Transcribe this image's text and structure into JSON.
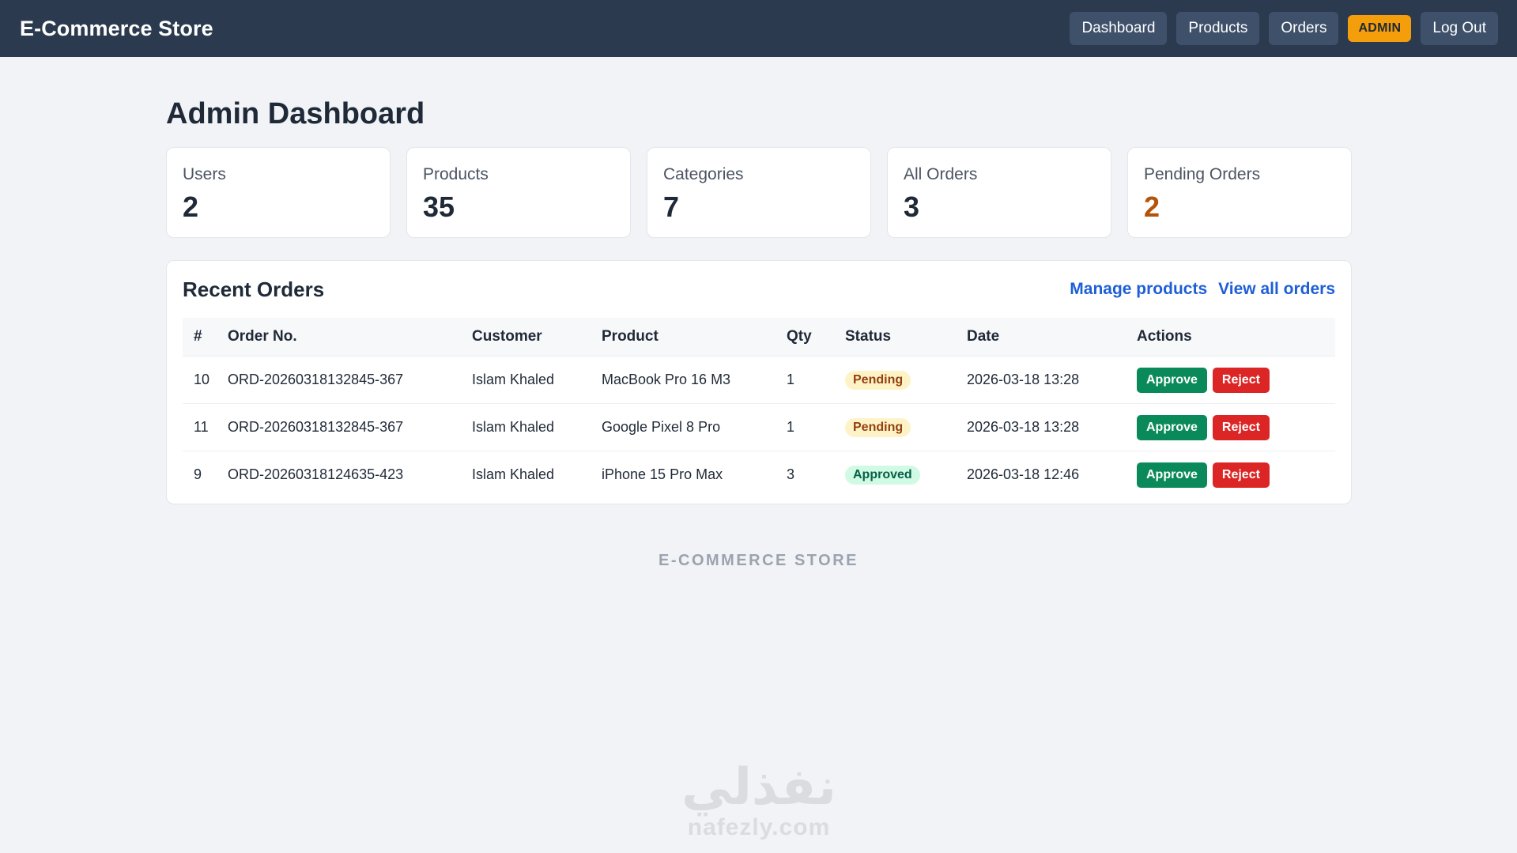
{
  "nav": {
    "brand": "E-Commerce Store",
    "links": [
      "Dashboard",
      "Products",
      "Orders"
    ],
    "admin_badge": "ADMIN",
    "logout": "Log Out"
  },
  "page": {
    "title": "Admin Dashboard"
  },
  "stats": [
    {
      "label": "Users",
      "value": "2"
    },
    {
      "label": "Products",
      "value": "35"
    },
    {
      "label": "Categories",
      "value": "7"
    },
    {
      "label": "All Orders",
      "value": "3"
    },
    {
      "label": "Pending Orders",
      "value": "2",
      "color": "#b45309"
    }
  ],
  "orders": {
    "title": "Recent Orders",
    "links": [
      "Manage products",
      "View all orders"
    ],
    "columns": [
      "#",
      "Order No.",
      "Customer",
      "Product",
      "Qty",
      "Status",
      "Date",
      "Actions"
    ],
    "rows": [
      {
        "id": "10",
        "order_no": "ORD-20260318132845-367",
        "customer": "Islam Khaled",
        "product": "MacBook Pro 16 M3",
        "qty": "1",
        "status": "Pending",
        "date": "2026-03-18 13:28"
      },
      {
        "id": "11",
        "order_no": "ORD-20260318132845-367",
        "customer": "Islam Khaled",
        "product": "Google Pixel 8 Pro",
        "qty": "1",
        "status": "Pending",
        "date": "2026-03-18 13:28"
      },
      {
        "id": "9",
        "order_no": "ORD-20260318124635-423",
        "customer": "Islam Khaled",
        "product": "iPhone 15 Pro Max",
        "qty": "3",
        "status": "Approved",
        "date": "2026-03-18 12:46"
      }
    ],
    "actions": {
      "approve": "Approve",
      "reject": "Reject"
    }
  },
  "footer": {
    "brand": "E-COMMERCE STORE"
  },
  "watermark": {
    "arabic": "نفذلي",
    "latin": "nafezly.com"
  },
  "colors": {
    "navbar": "#2b3a4e",
    "admin_badge": "#f59e0b",
    "approve": "#0a8a5a",
    "reject": "#dc2626",
    "link": "#1d5fd6"
  }
}
